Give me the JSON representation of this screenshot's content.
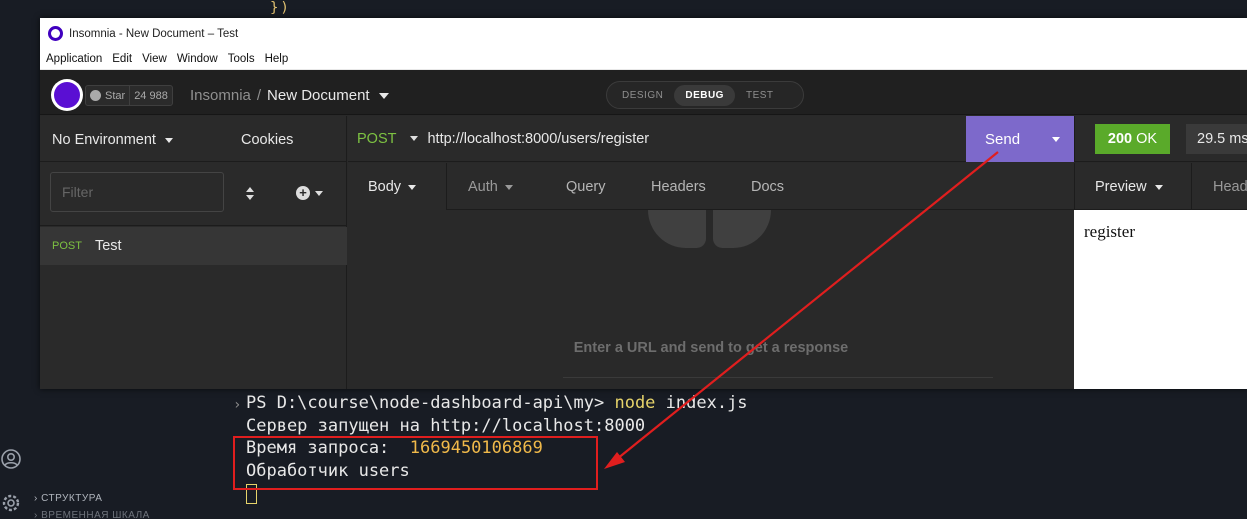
{
  "window": {
    "title": "Insomnia - New Document – Test",
    "menu": [
      "Application",
      "Edit",
      "View",
      "Window",
      "Tools",
      "Help"
    ]
  },
  "header": {
    "star_label": "Star",
    "star_count": "24 988",
    "workspace": "Insomnia",
    "separator": "/",
    "document": "New Document",
    "modes": [
      "DESIGN",
      "DEBUG",
      "TEST"
    ],
    "active_mode": "DEBUG"
  },
  "sidebar": {
    "environment": "No Environment",
    "cookies": "Cookies",
    "filter_placeholder": "Filter",
    "requests": [
      {
        "method": "POST",
        "name": "Test"
      }
    ]
  },
  "request": {
    "method": "POST",
    "url": "http://localhost:8000/users/register",
    "send_label": "Send",
    "tabs": [
      "Body",
      "Auth",
      "Query",
      "Headers",
      "Docs"
    ],
    "empty_message": "Enter a URL and send to get a response"
  },
  "response": {
    "status_code": "200",
    "status_text": "OK",
    "time": "29.5 ms",
    "preview_tab": "Preview",
    "headers_tab": "Header",
    "body": "register"
  },
  "terminal": {
    "prompt": "PS D:\\course\\node-dashboard-api\\my> ",
    "command": "node",
    "args": " index.js",
    "line2": "Сервер запущен на http://localhost:8000",
    "line3_label": "Время запроса:  ",
    "line3_value": "1669450106869",
    "line4": "Обработчик users"
  },
  "outline": {
    "item1": "СТРУКТУРА",
    "item2": "ВРЕМЕННАЯ ШКАЛА"
  },
  "colors": {
    "accent": "#7d69cb",
    "success": "#5aaa2a",
    "method_post": "#7dc242",
    "annotation": "#e01e1e"
  }
}
